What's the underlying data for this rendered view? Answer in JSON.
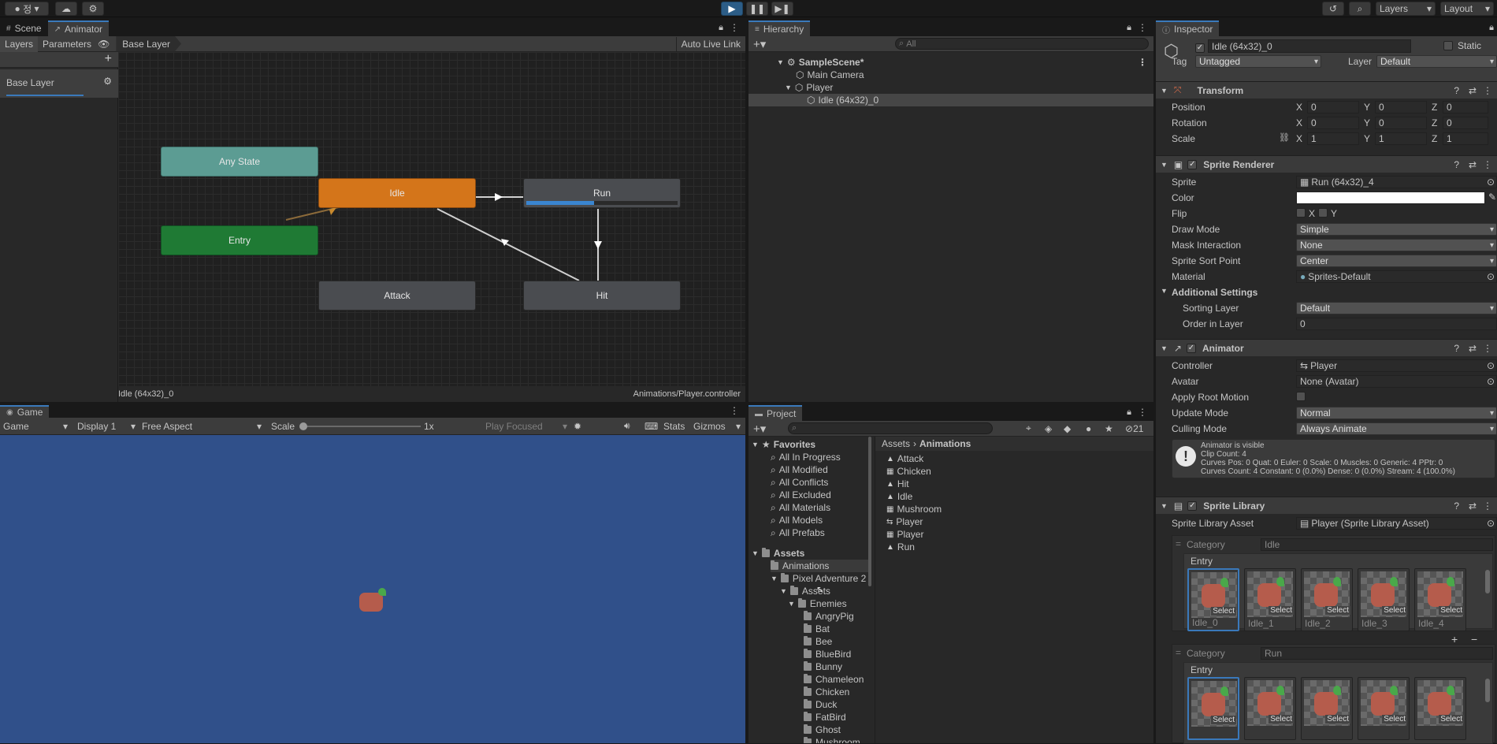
{
  "toolbar": {
    "account_label": "정",
    "play_icon": "play-icon",
    "pause_icon": "pause-icon",
    "step_icon": "step-icon",
    "layers_label": "Layers",
    "layout_label": "Layout"
  },
  "scene_tabs": {
    "scene": "Scene",
    "animator": "Animator"
  },
  "animator": {
    "layers_tab": "Layers",
    "parameters_tab": "Parameters",
    "breadcrumb": "Base Layer",
    "auto_live_link": "Auto Live Link",
    "layer_name": "Base Layer",
    "footer_left": "Idle (64x32)_0",
    "footer_right": "Animations/Player.controller",
    "nodes": {
      "any_state": "Any State",
      "entry": "Entry",
      "idle": "Idle",
      "run": "Run",
      "attack": "Attack",
      "hit": "Hit"
    },
    "run_progress": 0.45
  },
  "game": {
    "tab": "Game",
    "display_mode": "Game",
    "display": "Display 1",
    "aspect": "Free Aspect",
    "scale_label": "Scale",
    "scale_value": "1x",
    "play_focused": "Play Focused",
    "stats": "Stats",
    "gizmos": "Gizmos"
  },
  "hierarchy": {
    "tab": "Hierarchy",
    "search_placeholder": "All",
    "items": [
      "SampleScene*",
      "Main Camera",
      "Player",
      "Idle (64x32)_0"
    ]
  },
  "project": {
    "tab": "Project",
    "hidden_count": "21",
    "favorites_label": "Favorites",
    "favorites": [
      "All In Progress",
      "All Modified",
      "All Conflicts",
      "All Excluded",
      "All Materials",
      "All Models",
      "All Prefabs"
    ],
    "assets_label": "Assets",
    "tree": [
      "Animations",
      "Pixel Adventure 2",
      "Assets",
      "Enemies",
      "AngryPig",
      "Bat",
      "Bee",
      "BlueBird",
      "Bunny",
      "Chameleon",
      "Chicken",
      "Duck",
      "FatBird",
      "Ghost",
      "Mushroom"
    ],
    "breadcrumb": [
      "Assets",
      "Animations"
    ],
    "files": [
      "Attack",
      "Chicken",
      "Hit",
      "Idle",
      "Mushroom",
      "Player",
      "Player",
      "Run"
    ]
  },
  "inspector": {
    "tab": "Inspector",
    "object_name": "Idle (64x32)_0",
    "static_label": "Static",
    "tag_label": "Tag",
    "tag_value": "Untagged",
    "layer_label": "Layer",
    "layer_value": "Default",
    "transform": {
      "title": "Transform",
      "rows": [
        {
          "label": "Position",
          "x": "0",
          "y": "0",
          "z": "0"
        },
        {
          "label": "Rotation",
          "x": "0",
          "y": "0",
          "z": "0"
        },
        {
          "label": "Scale",
          "x": "1",
          "y": "1",
          "z": "1"
        }
      ]
    },
    "sprite_renderer": {
      "title": "Sprite Renderer",
      "sprite_label": "Sprite",
      "sprite_value": "Run (64x32)_4",
      "color_label": "Color",
      "color_value": "#ffffff",
      "flip_label": "Flip",
      "flip_x": "X",
      "flip_y": "Y",
      "draw_mode_label": "Draw Mode",
      "draw_mode": "Simple",
      "mask_label": "Mask Interaction",
      "mask": "None",
      "sort_point_label": "Sprite Sort Point",
      "sort_point": "Center",
      "material_label": "Material",
      "material": "Sprites-Default",
      "additional": "Additional Settings",
      "sorting_layer_label": "Sorting Layer",
      "sorting_layer": "Default",
      "order_label": "Order in Layer",
      "order": "0"
    },
    "animator": {
      "title": "Animator",
      "controller_label": "Controller",
      "controller": "Player",
      "avatar_label": "Avatar",
      "avatar": "None (Avatar)",
      "root_motion_label": "Apply Root Motion",
      "update_mode_label": "Update Mode",
      "update_mode": "Normal",
      "culling_label": "Culling Mode",
      "culling": "Always Animate",
      "info": [
        "Animator is visible",
        "Clip Count: 4",
        "Curves Pos: 0 Quat: 0 Euler: 0 Scale: 0 Muscles: 0 Generic: 4 PPtr: 0",
        "Curves Count: 4 Constant: 0 (0.0%) Dense: 0 (0.0%) Stream: 4 (100.0%)"
      ]
    },
    "sprite_library": {
      "title": "Sprite Library",
      "asset_label": "Sprite Library Asset",
      "asset": "Player (Sprite Library Asset)",
      "category_label": "Category",
      "category1": "Idle",
      "category2": "Run",
      "entry_label": "Entry",
      "select_label": "Select",
      "idle_frames": [
        "Idle_0",
        "Idle_1",
        "Idle_2",
        "Idle_3",
        "Idle_4"
      ]
    }
  }
}
